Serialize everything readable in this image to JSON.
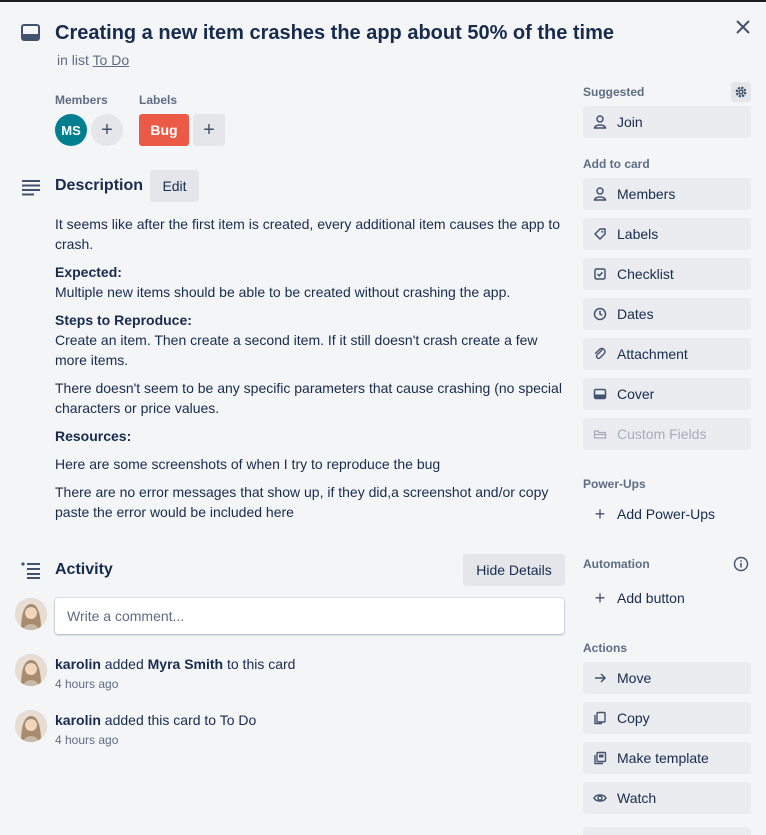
{
  "card": {
    "title": "Creating a new item crashes the app about 50% of the time",
    "in_list_prefix": "in list",
    "list_name": "To Do"
  },
  "members": {
    "label": "Members",
    "avatar_initials": "MS",
    "add_symbol": "+"
  },
  "labels": {
    "label": "Labels",
    "items": [
      {
        "text": "Bug",
        "color": "#eb5a46"
      }
    ],
    "add_symbol": "+"
  },
  "description": {
    "title": "Description",
    "edit_label": "Edit",
    "intro": "It seems like after the first item is created, every additional item causes the app to crash.",
    "expected_heading": "Expected:",
    "expected_text": "Multiple new items should be able to be created without crashing the app.",
    "steps_heading": "Steps to Reproduce:",
    "steps_text": "Create an item. Then create a second item. If it still doesn't crash create a few more items.",
    "params_text": "There doesn't seem to be any specific parameters that cause crashing (no special characters or price values.",
    "resources_heading": "Resources:",
    "resources_text": "Here are some screenshots of when I try to reproduce the bug",
    "errors_text": "There are no error messages that show up, if they did,a screenshot and/or copy paste the error would be included here"
  },
  "activity": {
    "title": "Activity",
    "hide_details_label": "Hide Details",
    "comment_placeholder": "Write a comment...",
    "entries": [
      {
        "user": "karolin",
        "action": "added",
        "target": "Myra Smith",
        "suffix": "to this card",
        "time": "4 hours ago"
      },
      {
        "user": "karolin",
        "action": "added this card to To Do",
        "time": "4 hours ago"
      }
    ]
  },
  "sidebar": {
    "suggested_label": "Suggested",
    "join_label": "Join",
    "add_to_card_label": "Add to card",
    "add_to_card": [
      {
        "label": "Members",
        "icon": "person-icon"
      },
      {
        "label": "Labels",
        "icon": "tag-icon"
      },
      {
        "label": "Checklist",
        "icon": "checklist-icon"
      },
      {
        "label": "Dates",
        "icon": "clock-icon"
      },
      {
        "label": "Attachment",
        "icon": "paperclip-icon"
      },
      {
        "label": "Cover",
        "icon": "cover-icon"
      },
      {
        "label": "Custom Fields",
        "icon": "custom-fields-icon"
      }
    ],
    "powerups_label": "Power-Ups",
    "add_powerups_label": "Add Power-Ups",
    "automation_label": "Automation",
    "add_button_label": "Add button",
    "actions_label": "Actions",
    "actions": [
      {
        "label": "Move",
        "icon": "arrow-right-icon"
      },
      {
        "label": "Copy",
        "icon": "copy-icon"
      },
      {
        "label": "Make template",
        "icon": "template-icon"
      },
      {
        "label": "Watch",
        "icon": "eye-icon"
      }
    ]
  }
}
